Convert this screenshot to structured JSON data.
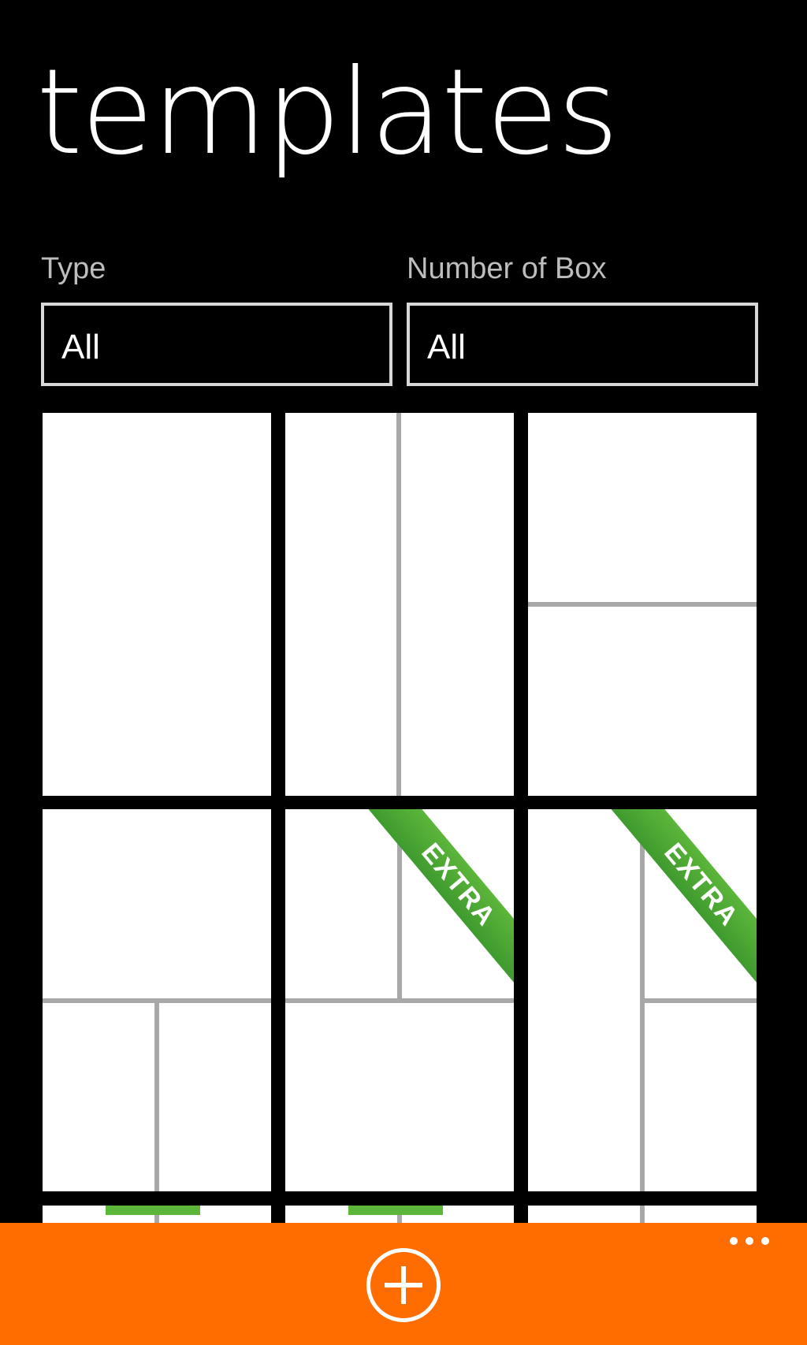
{
  "page": {
    "title": "templates"
  },
  "filters": {
    "type": {
      "label": "Type",
      "value": "All"
    },
    "boxes": {
      "label": "Number of Box",
      "value": "All"
    }
  },
  "templates": {
    "badge_text": "EXTRA",
    "items": [
      {
        "name": "template-1-box",
        "extra": false
      },
      {
        "name": "template-2-columns",
        "extra": false
      },
      {
        "name": "template-2-rows",
        "extra": false
      },
      {
        "name": "template-3-top-two-bottom",
        "extra": false
      },
      {
        "name": "template-3-two-top-one-bottom",
        "extra": true
      },
      {
        "name": "template-3-left-col-right-split",
        "extra": true
      }
    ]
  },
  "appbar": {
    "color": "#ff6d00",
    "add_icon": "add-circle-icon",
    "more_icon": "more-dots-icon"
  }
}
